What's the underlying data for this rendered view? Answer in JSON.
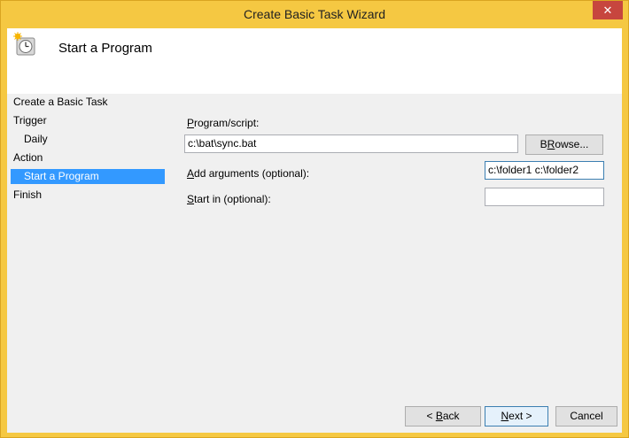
{
  "window": {
    "title": "Create Basic Task Wizard",
    "close_glyph": "✕"
  },
  "header": {
    "title": "Start a Program",
    "icon": "task-clock-icon"
  },
  "nav": {
    "items": [
      {
        "label": "Create a Basic Task"
      },
      {
        "label": "Trigger"
      },
      {
        "label": "Daily"
      },
      {
        "label": "Action"
      },
      {
        "label": "Start a Program"
      },
      {
        "label": "Finish"
      }
    ]
  },
  "form": {
    "program_label_key": "P",
    "program_label_rest": "rogram/script:",
    "program_value": "c:\\bat\\sync.bat",
    "browse_key": "R",
    "browse_pre": "B",
    "browse_rest": "owse...",
    "args_label_key": "A",
    "args_label_rest": "dd arguments (optional):",
    "args_value": "c:\\folder1 c:\\folder2",
    "start_label_key": "S",
    "start_label_rest": "tart in (optional):",
    "start_value": ""
  },
  "footer": {
    "back_pre": "< ",
    "back_key": "B",
    "back_rest": "ack",
    "next_key": "N",
    "next_rest": "ext >",
    "cancel_label": "Cancel"
  }
}
